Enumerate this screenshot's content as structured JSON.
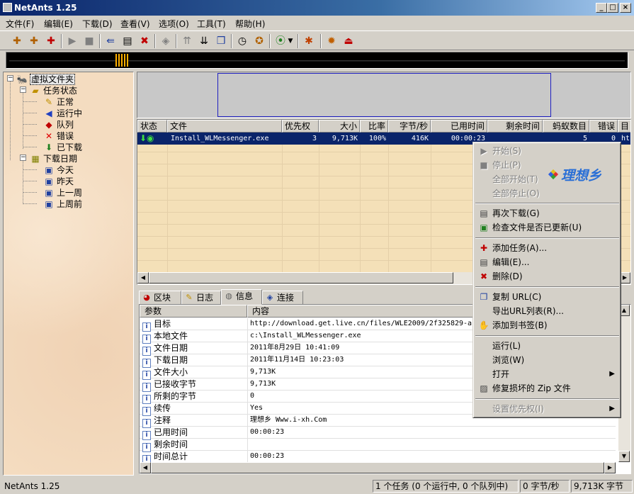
{
  "window": {
    "title": "NetAnts 1.25",
    "min": "_",
    "max": "□",
    "close": "×"
  },
  "menu": [
    "文件(F)",
    "编辑(E)",
    "下载(D)",
    "查看(V)",
    "选项(O)",
    "工具(T)",
    "帮助(H)"
  ],
  "tree": {
    "root": "虚拟文件夹",
    "task_status": "任务状态",
    "status_items": [
      "正常",
      "运行中",
      "队列",
      "错误",
      "已下载"
    ],
    "download_date": "下载日期",
    "date_items": [
      "今天",
      "昨天",
      "上一周",
      "上周前"
    ]
  },
  "task_table": {
    "headers": [
      "状态",
      "文件",
      "优先权",
      "大小",
      "比率",
      "字节/秒",
      "已用时间",
      "剩余时间",
      "蚂蚁数目",
      "错误",
      "目"
    ],
    "row": {
      "file": "Install_WLMessenger.exe",
      "priority": "3",
      "size": "9,713K",
      "ratio": "100%",
      "speed": "416K",
      "elapsed": "00:00:23",
      "ants": "5",
      "errors": "0",
      "target": "ht"
    }
  },
  "tabs": [
    "区块",
    "日志",
    "信息",
    "连接"
  ],
  "info": {
    "headers": [
      "参数",
      "内容"
    ],
    "rows": [
      {
        "k": "目标",
        "v": "http://download.get.live.cn/files/WLE2009/2f325829-a"
      },
      {
        "k": "本地文件",
        "v": "c:\\Install_WLMessenger.exe"
      },
      {
        "k": "文件日期",
        "v": "2011年8月29日 10:41:09"
      },
      {
        "k": "下载日期",
        "v": "2011年11月14日 10:23:03"
      },
      {
        "k": "文件大小",
        "v": "9,713K"
      },
      {
        "k": "已接收字节",
        "v": "9,713K"
      },
      {
        "k": "所剩的字节",
        "v": "0"
      },
      {
        "k": "续传",
        "v": "Yes"
      },
      {
        "k": "注释",
        "v": "理想乡 Www.i-xh.Com"
      },
      {
        "k": "已用时间",
        "v": "00:00:23"
      },
      {
        "k": "剩余时间",
        "v": ""
      },
      {
        "k": "时间总计",
        "v": "00:00:23"
      }
    ]
  },
  "context_menu": {
    "logo_text": "理想乡",
    "items": [
      {
        "label": "开始(S)",
        "disabled": true
      },
      {
        "label": "停止(P)",
        "disabled": true
      },
      {
        "label": "全部开始(T)",
        "disabled": true
      },
      {
        "label": "全部停止(O)",
        "disabled": true
      },
      {
        "label": "再次下载(G)",
        "disabled": false
      },
      {
        "label": "检查文件是否已更新(U)",
        "disabled": false
      },
      {
        "label": "添加任务(A)...",
        "disabled": false
      },
      {
        "label": "编辑(E)...",
        "disabled": false
      },
      {
        "label": "删除(D)",
        "disabled": false
      },
      {
        "label": "复制 URL(C)",
        "disabled": false
      },
      {
        "label": "导出URL列表(R)...",
        "disabled": false
      },
      {
        "label": "添加到书签(B)",
        "disabled": false
      },
      {
        "label": "运行(L)",
        "disabled": false
      },
      {
        "label": "浏览(W)",
        "disabled": false
      },
      {
        "label": "打开",
        "disabled": false
      },
      {
        "label": "修复损坏的 Zip 文件",
        "disabled": false
      },
      {
        "label": "设置优先权(I)",
        "disabled": true
      }
    ]
  },
  "status": {
    "left": "NetAnts 1.25",
    "tasks": "1 个任务 (0 个运行中, 0 个队列中)",
    "speed": "0 字节/秒",
    "total": "9,713K 字节"
  }
}
